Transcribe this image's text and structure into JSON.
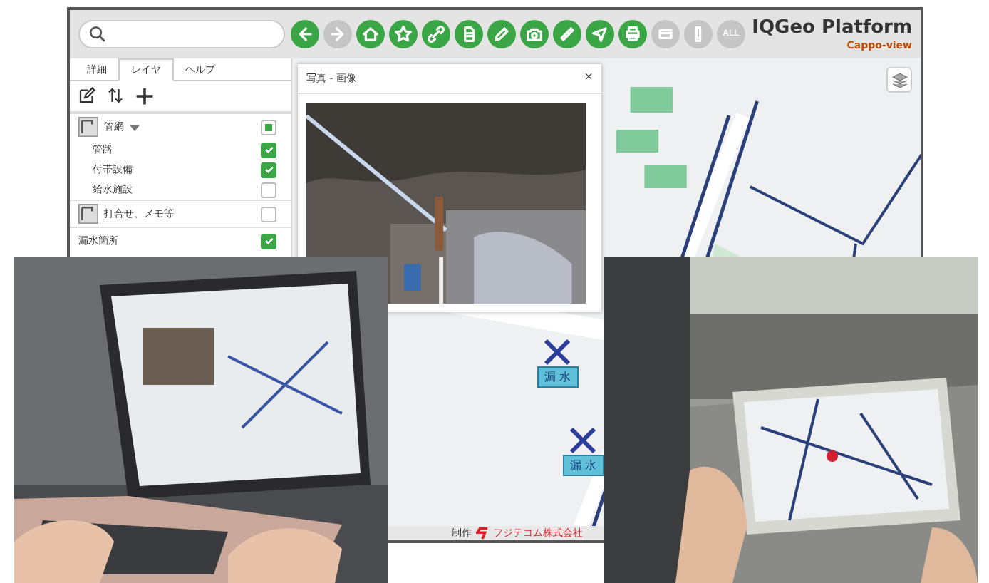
{
  "toolbar": [
    {
      "enabled": true
    },
    {
      "enabled": false
    },
    {
      "enabled": true
    },
    {
      "enabled": true
    },
    {
      "enabled": true
    },
    {
      "enabled": true
    },
    {
      "enabled": true
    },
    {
      "enabled": true
    },
    {
      "enabled": true
    },
    {
      "enabled": true
    },
    {
      "enabled": true
    },
    {
      "enabled": false
    },
    {
      "enabled": false
    },
    {
      "enabled": false,
      "label": "ALL"
    }
  ],
  "logo": {
    "title": "IQGeo Platform",
    "subtitle": "Cappo-view"
  },
  "sidebar": {
    "tabs": [
      {
        "label": "詳細",
        "selected": false
      },
      {
        "label": "レイヤ",
        "selected": true
      },
      {
        "label": "ヘルプ",
        "selected": false
      }
    ],
    "layers": [
      {
        "kind": "group",
        "label": "管網",
        "checked": true,
        "partial": true,
        "expanded": true,
        "children": [
          {
            "label": "管路",
            "checked": true
          },
          {
            "label": "付帯設備",
            "checked": true
          },
          {
            "label": "給水施設",
            "checked": false
          }
        ]
      },
      {
        "kind": "group",
        "label": "打合せ、メモ等",
        "checked": false
      },
      {
        "kind": "plain",
        "label": "漏水箇所",
        "checked": true
      }
    ]
  },
  "popup": {
    "title": "写真 - 画像",
    "close": "×"
  },
  "map_markers": [
    {
      "label": "漏 水"
    },
    {
      "label": "漏 水"
    }
  ],
  "map_footer": {
    "prefix": "制作",
    "company": "フジテコム株式会社"
  }
}
